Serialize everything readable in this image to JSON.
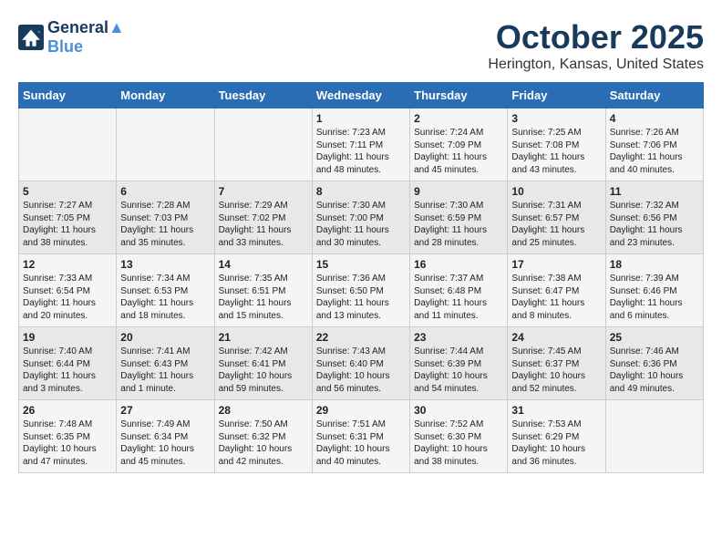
{
  "header": {
    "logo_line1": "General",
    "logo_line2": "Blue",
    "title": "October 2025",
    "subtitle": "Herington, Kansas, United States"
  },
  "days_of_week": [
    "Sunday",
    "Monday",
    "Tuesday",
    "Wednesday",
    "Thursday",
    "Friday",
    "Saturday"
  ],
  "weeks": [
    [
      {
        "day": "",
        "info": ""
      },
      {
        "day": "",
        "info": ""
      },
      {
        "day": "",
        "info": ""
      },
      {
        "day": "1",
        "info": "Sunrise: 7:23 AM\nSunset: 7:11 PM\nDaylight: 11 hours\nand 48 minutes."
      },
      {
        "day": "2",
        "info": "Sunrise: 7:24 AM\nSunset: 7:09 PM\nDaylight: 11 hours\nand 45 minutes."
      },
      {
        "day": "3",
        "info": "Sunrise: 7:25 AM\nSunset: 7:08 PM\nDaylight: 11 hours\nand 43 minutes."
      },
      {
        "day": "4",
        "info": "Sunrise: 7:26 AM\nSunset: 7:06 PM\nDaylight: 11 hours\nand 40 minutes."
      }
    ],
    [
      {
        "day": "5",
        "info": "Sunrise: 7:27 AM\nSunset: 7:05 PM\nDaylight: 11 hours\nand 38 minutes."
      },
      {
        "day": "6",
        "info": "Sunrise: 7:28 AM\nSunset: 7:03 PM\nDaylight: 11 hours\nand 35 minutes."
      },
      {
        "day": "7",
        "info": "Sunrise: 7:29 AM\nSunset: 7:02 PM\nDaylight: 11 hours\nand 33 minutes."
      },
      {
        "day": "8",
        "info": "Sunrise: 7:30 AM\nSunset: 7:00 PM\nDaylight: 11 hours\nand 30 minutes."
      },
      {
        "day": "9",
        "info": "Sunrise: 7:30 AM\nSunset: 6:59 PM\nDaylight: 11 hours\nand 28 minutes."
      },
      {
        "day": "10",
        "info": "Sunrise: 7:31 AM\nSunset: 6:57 PM\nDaylight: 11 hours\nand 25 minutes."
      },
      {
        "day": "11",
        "info": "Sunrise: 7:32 AM\nSunset: 6:56 PM\nDaylight: 11 hours\nand 23 minutes."
      }
    ],
    [
      {
        "day": "12",
        "info": "Sunrise: 7:33 AM\nSunset: 6:54 PM\nDaylight: 11 hours\nand 20 minutes."
      },
      {
        "day": "13",
        "info": "Sunrise: 7:34 AM\nSunset: 6:53 PM\nDaylight: 11 hours\nand 18 minutes."
      },
      {
        "day": "14",
        "info": "Sunrise: 7:35 AM\nSunset: 6:51 PM\nDaylight: 11 hours\nand 15 minutes."
      },
      {
        "day": "15",
        "info": "Sunrise: 7:36 AM\nSunset: 6:50 PM\nDaylight: 11 hours\nand 13 minutes."
      },
      {
        "day": "16",
        "info": "Sunrise: 7:37 AM\nSunset: 6:48 PM\nDaylight: 11 hours\nand 11 minutes."
      },
      {
        "day": "17",
        "info": "Sunrise: 7:38 AM\nSunset: 6:47 PM\nDaylight: 11 hours\nand 8 minutes."
      },
      {
        "day": "18",
        "info": "Sunrise: 7:39 AM\nSunset: 6:46 PM\nDaylight: 11 hours\nand 6 minutes."
      }
    ],
    [
      {
        "day": "19",
        "info": "Sunrise: 7:40 AM\nSunset: 6:44 PM\nDaylight: 11 hours\nand 3 minutes."
      },
      {
        "day": "20",
        "info": "Sunrise: 7:41 AM\nSunset: 6:43 PM\nDaylight: 11 hours\nand 1 minute."
      },
      {
        "day": "21",
        "info": "Sunrise: 7:42 AM\nSunset: 6:41 PM\nDaylight: 10 hours\nand 59 minutes."
      },
      {
        "day": "22",
        "info": "Sunrise: 7:43 AM\nSunset: 6:40 PM\nDaylight: 10 hours\nand 56 minutes."
      },
      {
        "day": "23",
        "info": "Sunrise: 7:44 AM\nSunset: 6:39 PM\nDaylight: 10 hours\nand 54 minutes."
      },
      {
        "day": "24",
        "info": "Sunrise: 7:45 AM\nSunset: 6:37 PM\nDaylight: 10 hours\nand 52 minutes."
      },
      {
        "day": "25",
        "info": "Sunrise: 7:46 AM\nSunset: 6:36 PM\nDaylight: 10 hours\nand 49 minutes."
      }
    ],
    [
      {
        "day": "26",
        "info": "Sunrise: 7:48 AM\nSunset: 6:35 PM\nDaylight: 10 hours\nand 47 minutes."
      },
      {
        "day": "27",
        "info": "Sunrise: 7:49 AM\nSunset: 6:34 PM\nDaylight: 10 hours\nand 45 minutes."
      },
      {
        "day": "28",
        "info": "Sunrise: 7:50 AM\nSunset: 6:32 PM\nDaylight: 10 hours\nand 42 minutes."
      },
      {
        "day": "29",
        "info": "Sunrise: 7:51 AM\nSunset: 6:31 PM\nDaylight: 10 hours\nand 40 minutes."
      },
      {
        "day": "30",
        "info": "Sunrise: 7:52 AM\nSunset: 6:30 PM\nDaylight: 10 hours\nand 38 minutes."
      },
      {
        "day": "31",
        "info": "Sunrise: 7:53 AM\nSunset: 6:29 PM\nDaylight: 10 hours\nand 36 minutes."
      },
      {
        "day": "",
        "info": ""
      }
    ]
  ]
}
